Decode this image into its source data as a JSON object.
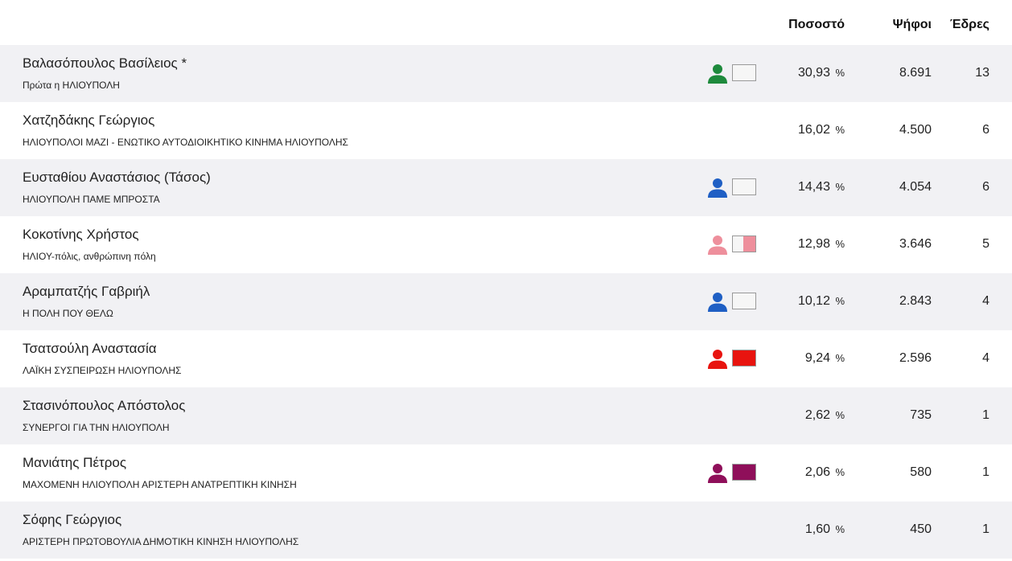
{
  "header": {
    "percent_label": "Ποσοστό",
    "votes_label": "Ψήφοι",
    "seats_label": "Έδρες"
  },
  "results": [
    {
      "name": "Βαλασόπουλος Βασίλειος *",
      "party": "Πρώτα η ΗΛΙΟΥΠΟΛΗ",
      "percent": "30,93",
      "percent_unit": "%",
      "votes": "8.691",
      "seats": "13",
      "icon": "person-icon",
      "icon_color": "#1e8a3c",
      "swatch_fill": 0,
      "swatch_color": "#1e8a3c"
    },
    {
      "name": "Χατζηδάκης Γεώργιος",
      "party": "ΗΛΙΟΥΠΟΛΟΙ ΜΑΖΙ - ΕΝΩΤΙΚΟ ΑΥΤΟΔΙΟΙΚΗΤΙΚΟ ΚΙΝΗΜΑ ΗΛΙΟΥΠΟΛΗΣ",
      "percent": "16,02",
      "percent_unit": "%",
      "votes": "4.500",
      "seats": "6",
      "icon": null
    },
    {
      "name": "Ευσταθίου Αναστάσιος (Τάσος)",
      "party": "ΗΛΙΟΥΠΟΛΗ ΠΑΜΕ ΜΠΡΟΣΤΑ",
      "percent": "14,43",
      "percent_unit": "%",
      "votes": "4.054",
      "seats": "6",
      "icon": "person-icon",
      "icon_color": "#1f5fc4",
      "swatch_fill": 0,
      "swatch_color": "#1f5fc4"
    },
    {
      "name": "Κοκοτίνης Χρήστος",
      "party": "ΗΛΙΟΥ-πόλις, ανθρώπινη πόλη",
      "percent": "12,98",
      "percent_unit": "%",
      "votes": "3.646",
      "seats": "5",
      "icon": "person-icon",
      "icon_color": "#ee8f9c",
      "swatch_fill": 0.55,
      "swatch_color": "#ee8f9c"
    },
    {
      "name": "Αραμπατζής Γαβριήλ",
      "party": "Η ΠΟΛΗ ΠΟΥ ΘΕΛΩ",
      "percent": "10,12",
      "percent_unit": "%",
      "votes": "2.843",
      "seats": "4",
      "icon": "person-icon",
      "icon_color": "#1f5fc4",
      "swatch_fill": 0,
      "swatch_color": "#1f5fc4"
    },
    {
      "name": "Τσατσούλη Αναστασία",
      "party": "ΛΑΪΚΗ ΣΥΣΠΕΙΡΩΣΗ ΗΛΙΟΥΠΟΛΗΣ",
      "percent": "9,24",
      "percent_unit": "%",
      "votes": "2.596",
      "seats": "4",
      "icon": "person-icon",
      "icon_color": "#e8140f",
      "swatch_fill": 1,
      "swatch_color": "#e8140f"
    },
    {
      "name": "Στασινόπουλος Απόστολος",
      "party": "ΣΥΝΕΡΓΟΙ ΓΙΑ ΤΗΝ ΗΛΙΟΥΠΟΛΗ",
      "percent": "2,62",
      "percent_unit": "%",
      "votes": "735",
      "seats": "1",
      "icon": null
    },
    {
      "name": "Μανιάτης Πέτρος",
      "party": "ΜΑΧΟΜΕΝΗ ΗΛΙΟΥΠΟΛΗ ΑΡΙΣΤΕΡΗ ΑΝΑΤΡΕΠΤΙΚΗ ΚΙΝΗΣΗ",
      "percent": "2,06",
      "percent_unit": "%",
      "votes": "580",
      "seats": "1",
      "icon": "person-icon",
      "icon_color": "#8f0f5a",
      "swatch_fill": 1,
      "swatch_color": "#8f0f5a"
    },
    {
      "name": "Σόφης Γεώργιος",
      "party": "ΑΡΙΣΤΕΡΗ ΠΡΩΤΟΒΟΥΛΙΑ ΔΗΜΟΤΙΚΗ ΚΙΝΗΣΗ ΗΛΙΟΥΠΟΛΗΣ",
      "percent": "1,60",
      "percent_unit": "%",
      "votes": "450",
      "seats": "1",
      "icon": null
    }
  ]
}
